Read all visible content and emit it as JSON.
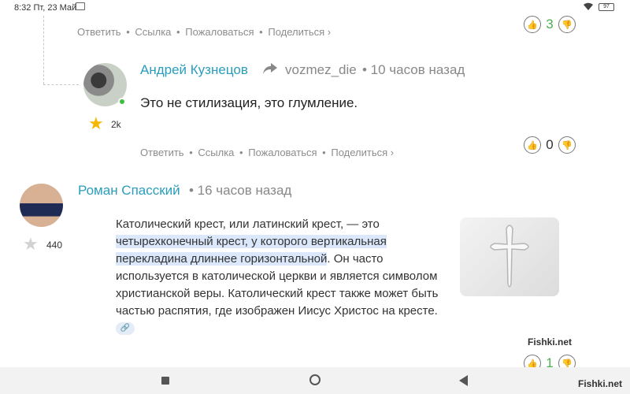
{
  "statusbar": {
    "time": "8:32",
    "date": "Пт, 23 Май",
    "battery": "97"
  },
  "actions": {
    "reply": "Ответить",
    "link": "Ссылка",
    "report": "Пожаловаться",
    "share": "Поделиться ›",
    "dot": "•"
  },
  "comments": [
    {
      "votes": "3"
    },
    {
      "author": "Андрей Кузнецов",
      "reply_to": "vozmez_die",
      "time": "• 10 часов назад",
      "text": "Это не стилизация, это глумление.",
      "rating": "2k",
      "votes": "0"
    },
    {
      "author": "Роман Спасский",
      "time": "• 16 часов назад",
      "rating": "440",
      "votes": "1",
      "quote": {
        "line1": "Католический крест, или латинский крест, — это",
        "hl1": "четырехконечный крест, у которого вертикальная",
        "hl2": "перекладина длиннее горизонтальной",
        "rest": ". Он часто используется в католической церкви и является символом христианской веры. Католический крест также может быть частью распятия, где изображен Иисус Христос на кресте."
      }
    }
  ],
  "watermarks": {
    "image": "Fishki.net",
    "corner": "Fishki.net"
  },
  "colors": {
    "author": "#2a9dbc",
    "online": "#3dbd3d",
    "vote_green": "#4caf50",
    "star_gold": "#f5b800",
    "highlight": "#dbe8fb"
  },
  "icons": [
    "gmail-icon",
    "wifi-icon",
    "battery-icon",
    "reply-arrow-icon",
    "like-icon",
    "dislike-icon",
    "star-icon",
    "link-icon",
    "cross-image",
    "nav-square-icon",
    "nav-circle-icon",
    "nav-back-icon"
  ]
}
